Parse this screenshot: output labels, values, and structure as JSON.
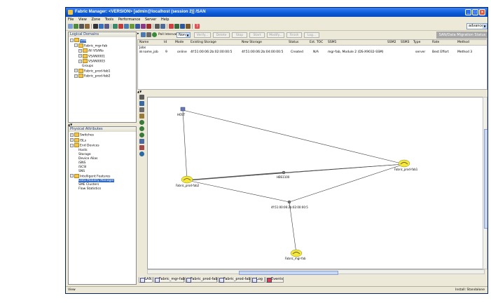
{
  "window": {
    "title": "Fabric Manager: <VERSION> [admin@localhost (session 2)] /SAN"
  },
  "menubar": [
    "File",
    "View",
    "Zone",
    "Tools",
    "Performance",
    "Server",
    "Help"
  ],
  "toolbar": {
    "advanced_combo": "advanced"
  },
  "logical_domains": {
    "header": "Logical Domains",
    "tree": [
      {
        "label": "SAN",
        "level": 0,
        "selected": true
      },
      {
        "label": "Fabric_mgr-fab",
        "level": 1
      },
      {
        "label": "All VSANs",
        "level": 2
      },
      {
        "label": "VSAN0001",
        "level": 2
      },
      {
        "label": "VSAN0003",
        "level": 2
      },
      {
        "label": "Groups",
        "level": 2
      },
      {
        "label": "Fabric_prod-fab1",
        "level": 1
      },
      {
        "label": "Fabric_prod-fab2",
        "level": 1
      }
    ]
  },
  "physical_attributes": {
    "header": "Physical Attributes",
    "tree": [
      {
        "label": "Switches",
        "level": 0
      },
      {
        "label": "ISLs",
        "level": 0
      },
      {
        "label": "End Devices",
        "level": 0
      },
      {
        "label": "Hosts",
        "level": 1
      },
      {
        "label": "Storage",
        "level": 1
      },
      {
        "label": "Device Alias",
        "level": 1
      },
      {
        "label": "iSNS",
        "level": 1
      },
      {
        "label": "iSCSI",
        "level": 1
      },
      {
        "label": "SNS",
        "level": 1
      },
      {
        "label": "Intelligent Features",
        "level": 0
      },
      {
        "label": "Data Mobility Manager",
        "level": 1,
        "selected": true
      },
      {
        "label": "SME Clusters",
        "level": 1
      },
      {
        "label": "Flow Statistics",
        "level": 1
      }
    ]
  },
  "job_toolbar": {
    "poll_label": "Poll Interval:",
    "poll_value": "None",
    "buttons": [
      "Verify...",
      "Delete",
      "Stop",
      "Start",
      "Modify...",
      "Finish",
      "Log..."
    ],
    "right_header": "SAN/Data Migration Status"
  },
  "jobs_table": {
    "columns": [
      "Name",
      "Id",
      "Mode",
      "Existing Storage",
      "New Storage",
      "Status",
      "Est. TOC",
      "SSM1",
      "SSM2",
      "SSM3",
      "Type",
      "Rate",
      "Method"
    ],
    "group_label": "Jobs",
    "rows": [
      [
        "name_job",
        "9",
        "online",
        "4f:51:00:06:2b:02:00:00:5",
        "4f:51:00:06:2b:04:00:00:5",
        "Created",
        "N/A",
        "mgr-fab, Module 2 (DS-X9032-SSM)",
        "",
        "",
        "server",
        "Best Effort",
        "Method 3"
      ]
    ]
  },
  "topology": {
    "nodes": {
      "host": "HOST",
      "fab2": "Fabric_prod-fab2",
      "fab1": "Fabric_prod-fab1",
      "hbs": "HBS1100",
      "wwn": "4f:51:00:06:2b:02:00:00:5",
      "mgr": "Fabric_mgr-fab"
    }
  },
  "tabs": [
    {
      "label": "SAN"
    },
    {
      "label": "Fabric_mgr-fab"
    },
    {
      "label": "Fabric_prod-fab1"
    },
    {
      "label": "Fabric_prod-fab2"
    },
    {
      "label": "Log"
    },
    {
      "label": "Events"
    }
  ],
  "statusbar": {
    "left": "View",
    "right": "Install: Standalone"
  },
  "colors": {
    "titlebar": "#0a5ad6",
    "selection": "#316ac5",
    "cloud": "#f4e73a",
    "link_line": "#3a3a3a"
  }
}
